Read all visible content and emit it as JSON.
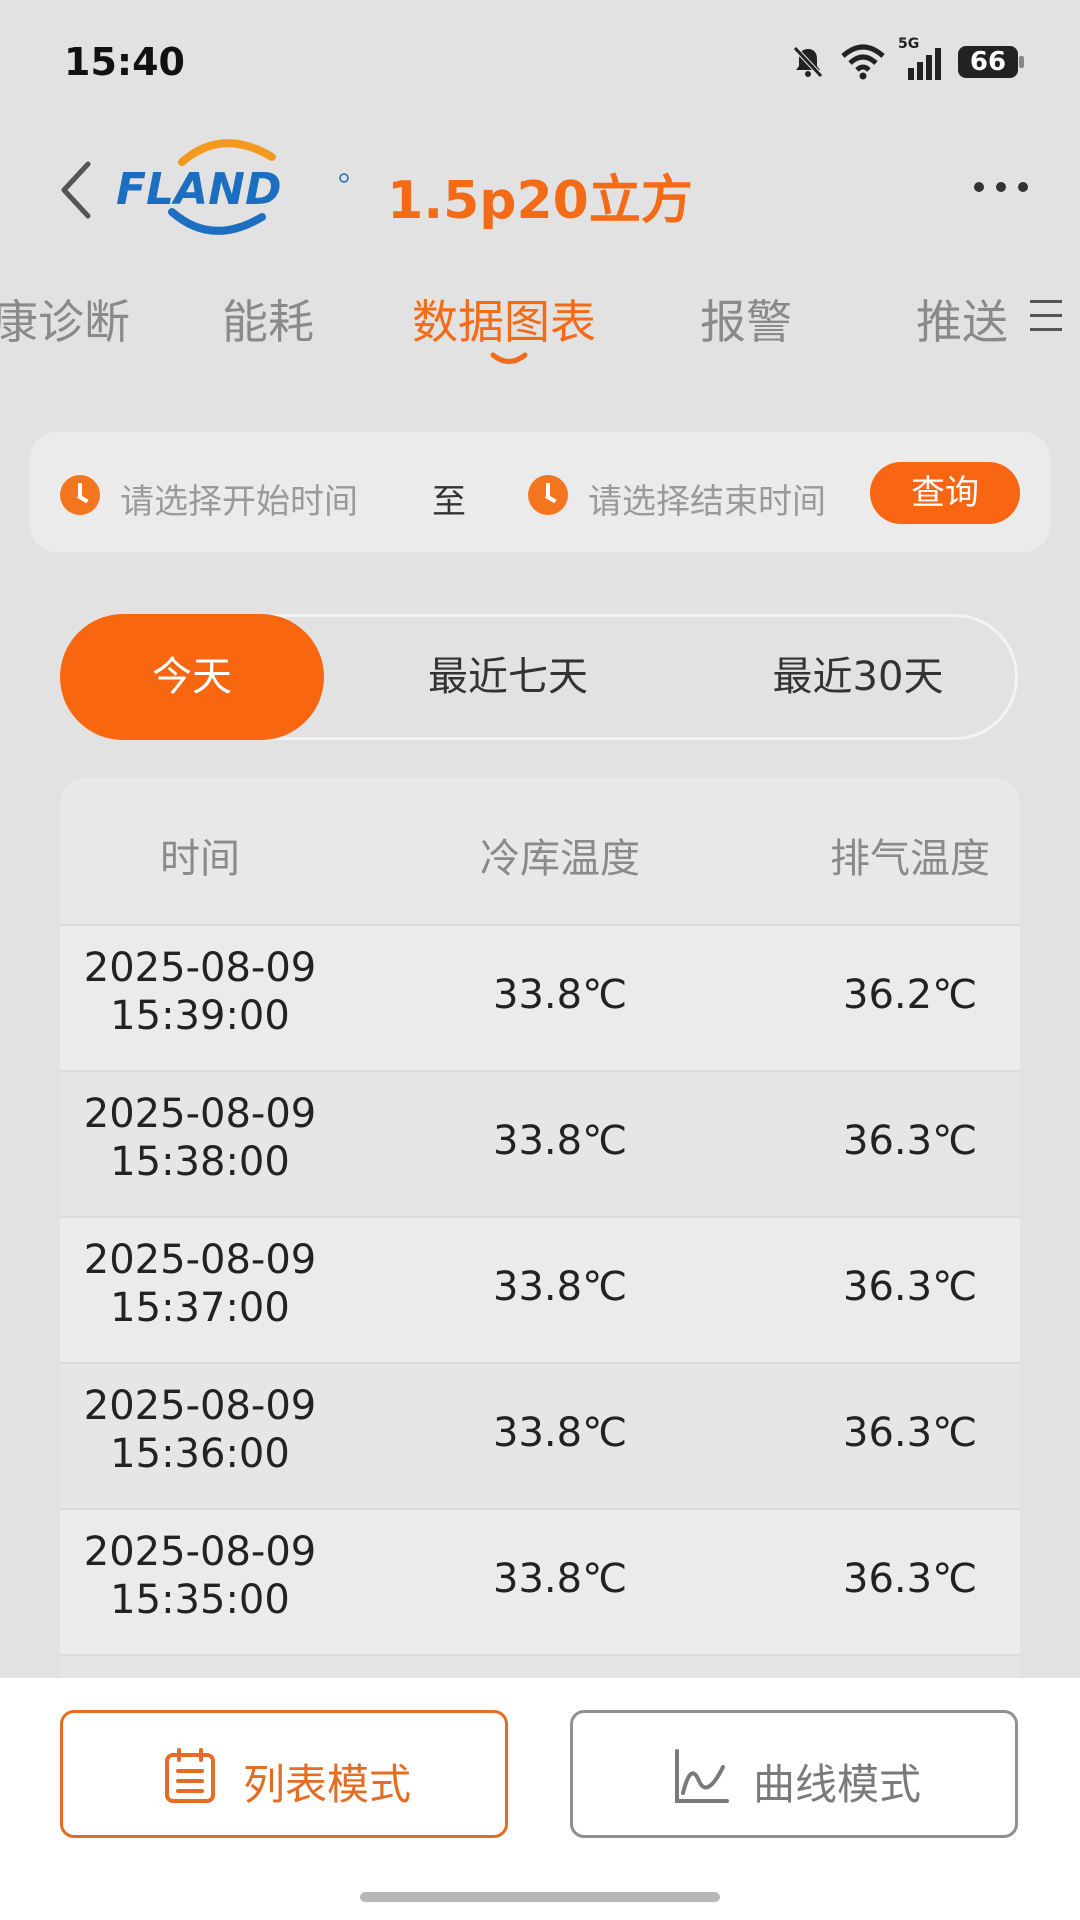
{
  "status": {
    "time": "15:40",
    "network": "5G",
    "battery": "66"
  },
  "header": {
    "logo_text": "FLAND",
    "title": "1.5p20立方"
  },
  "tabs": [
    {
      "label": "康诊断"
    },
    {
      "label": "能耗"
    },
    {
      "label": "数据图表",
      "active": true
    },
    {
      "label": "报警"
    },
    {
      "label": "推送"
    }
  ],
  "date_range": {
    "start_placeholder": "请选择开始时间",
    "separator": "至",
    "end_placeholder": "请选择结束时间",
    "query_label": "查询"
  },
  "periods": {
    "today": "今天",
    "last7": "最近七天",
    "last30": "最近30天",
    "selected": "今天"
  },
  "table": {
    "headers": [
      "时间",
      "冷库温度",
      "排气温度"
    ],
    "rows": [
      {
        "date": "2025-08-09",
        "time": "15:39:00",
        "cold": "33.8℃",
        "exhaust": "36.2℃"
      },
      {
        "date": "2025-08-09",
        "time": "15:38:00",
        "cold": "33.8℃",
        "exhaust": "36.3℃"
      },
      {
        "date": "2025-08-09",
        "time": "15:37:00",
        "cold": "33.8℃",
        "exhaust": "36.3℃"
      },
      {
        "date": "2025-08-09",
        "time": "15:36:00",
        "cold": "33.8℃",
        "exhaust": "36.3℃"
      },
      {
        "date": "2025-08-09",
        "time": "15:35:00",
        "cold": "33.8℃",
        "exhaust": "36.3℃"
      }
    ]
  },
  "bottom": {
    "list_mode": "列表模式",
    "curve_mode": "曲线模式"
  },
  "colors": {
    "accent": "#f86513",
    "logo_blue": "#1c6fc0"
  }
}
